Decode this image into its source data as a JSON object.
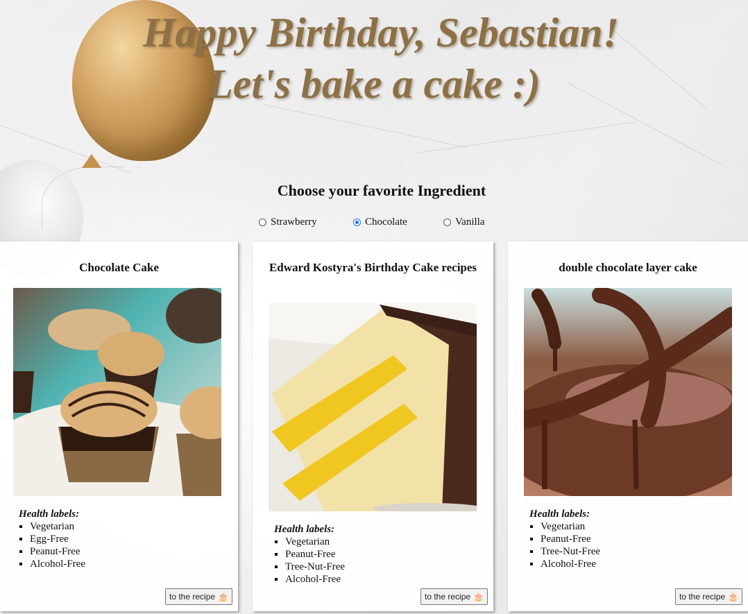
{
  "title": {
    "line1": "Happy Birthday, Sebastian!",
    "line2": "Let's bake a cake :)"
  },
  "chooser": {
    "heading": "Choose your favorite Ingredient",
    "options": [
      {
        "label": "Strawberry",
        "checked": false
      },
      {
        "label": "Chocolate",
        "checked": true
      },
      {
        "label": "Vanilla",
        "checked": false
      }
    ]
  },
  "cards": [
    {
      "title": "Chocolate Cake",
      "image": "peanut-butter-chocolate-cupcakes",
      "health_title": "Health labels:",
      "labels": [
        "Vegetarian",
        "Egg-Free",
        "Peanut-Free",
        "Alcohol-Free"
      ],
      "button": "to the recipe",
      "button_icon": "cake-icon"
    },
    {
      "title": "Edward Kostyra's Birthday Cake recipes",
      "image": "layer-cake-slice",
      "health_title": "Health labels:",
      "labels": [
        "Vegetarian",
        "Peanut-Free",
        "Tree-Nut-Free",
        "Alcohol-Free"
      ],
      "button": "to the recipe",
      "button_icon": "cake-icon"
    },
    {
      "title": "double chocolate layer cake",
      "image": "melted-chocolate-whisk",
      "health_title": "Health labels:",
      "labels": [
        "Vegetarian",
        "Peanut-Free",
        "Tree-Nut-Free",
        "Alcohol-Free"
      ],
      "button": "to the recipe",
      "button_icon": "cake-icon"
    }
  ],
  "colors": {
    "title": "#8d7046",
    "radio_checked": "#1a73e8",
    "balloon_gold": "#c6924e"
  }
}
